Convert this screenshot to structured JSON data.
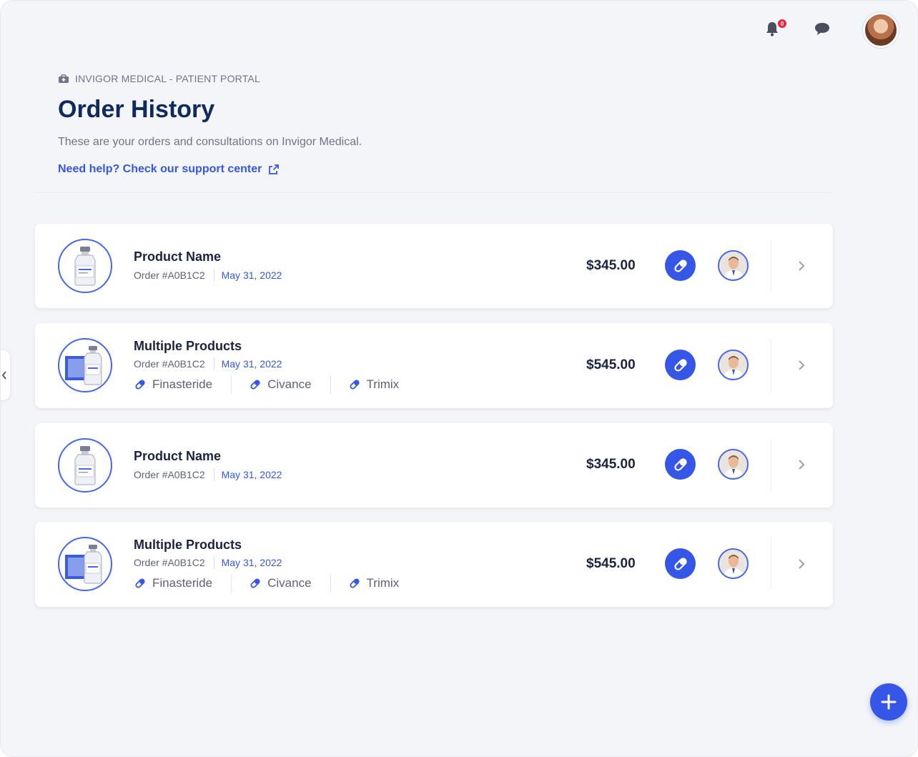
{
  "topbar": {
    "notification_count": "0",
    "icons": [
      "bell-icon",
      "chat-icon",
      "user-avatar"
    ]
  },
  "header": {
    "breadcrumb": "INVIGOR MEDICAL - PATIENT PORTAL",
    "title": "Order History",
    "subtitle": "These are your orders and consultations on Invigor Medical.",
    "support_link": "Need help? Check our support center"
  },
  "orders": [
    {
      "title": "Product Name",
      "order_number": "Order #A0B1C2",
      "date": "May 31, 2022",
      "price": "$345.00",
      "products": []
    },
    {
      "title": "Multiple Products",
      "order_number": "Order #A0B1C2",
      "date": "May 31, 2022",
      "price": "$545.00",
      "products": [
        "Finasteride",
        "Civance",
        "Trimix"
      ]
    },
    {
      "title": "Product Name",
      "order_number": "Order #A0B1C2",
      "date": "May 31, 2022",
      "price": "$345.00",
      "products": []
    },
    {
      "title": "Multiple Products",
      "order_number": "Order #A0B1C2",
      "date": "May 31, 2022",
      "price": "$545.00",
      "products": [
        "Finasteride",
        "Civance",
        "Trimix"
      ]
    }
  ],
  "colors": {
    "accent": "#3556e6",
    "title": "#0f2a5f",
    "background": "#f4f5f9",
    "badge": "#f0223f"
  }
}
